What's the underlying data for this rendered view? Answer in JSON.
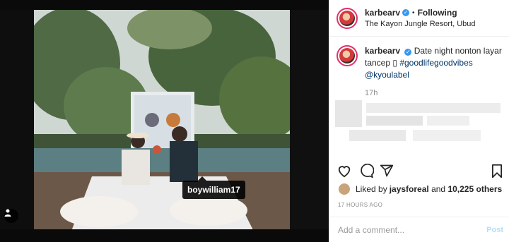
{
  "post": {
    "author": {
      "username": "karbearv",
      "verified_icon": "verified-badge-icon",
      "location": "The Kayon Jungle Resort, Ubud"
    },
    "header": {
      "separator": "•",
      "follow_state": "Following"
    },
    "media": {
      "tagged_user": "boywilliam17",
      "user_tag_icon": "user-tag-icon"
    },
    "caption": {
      "username": "karbearv",
      "text": "Date night nonton layar tancep ",
      "emoji": "▯",
      "hashtag": "#goodlifegoodvibes",
      "mention": "@kyoulabel",
      "time_ago": "17h"
    },
    "actions": {
      "like_icon": "heart-icon",
      "comment_icon": "comment-icon",
      "share_icon": "share-icon",
      "save_icon": "bookmark-icon"
    },
    "likes": {
      "prefix": "Liked by ",
      "user": "jaysforeal",
      "connector": " and ",
      "others": "10,225 others"
    },
    "timestamp": "17 HOURS AGO",
    "comment": {
      "placeholder": "Add a comment...",
      "post_label": "Post"
    }
  }
}
